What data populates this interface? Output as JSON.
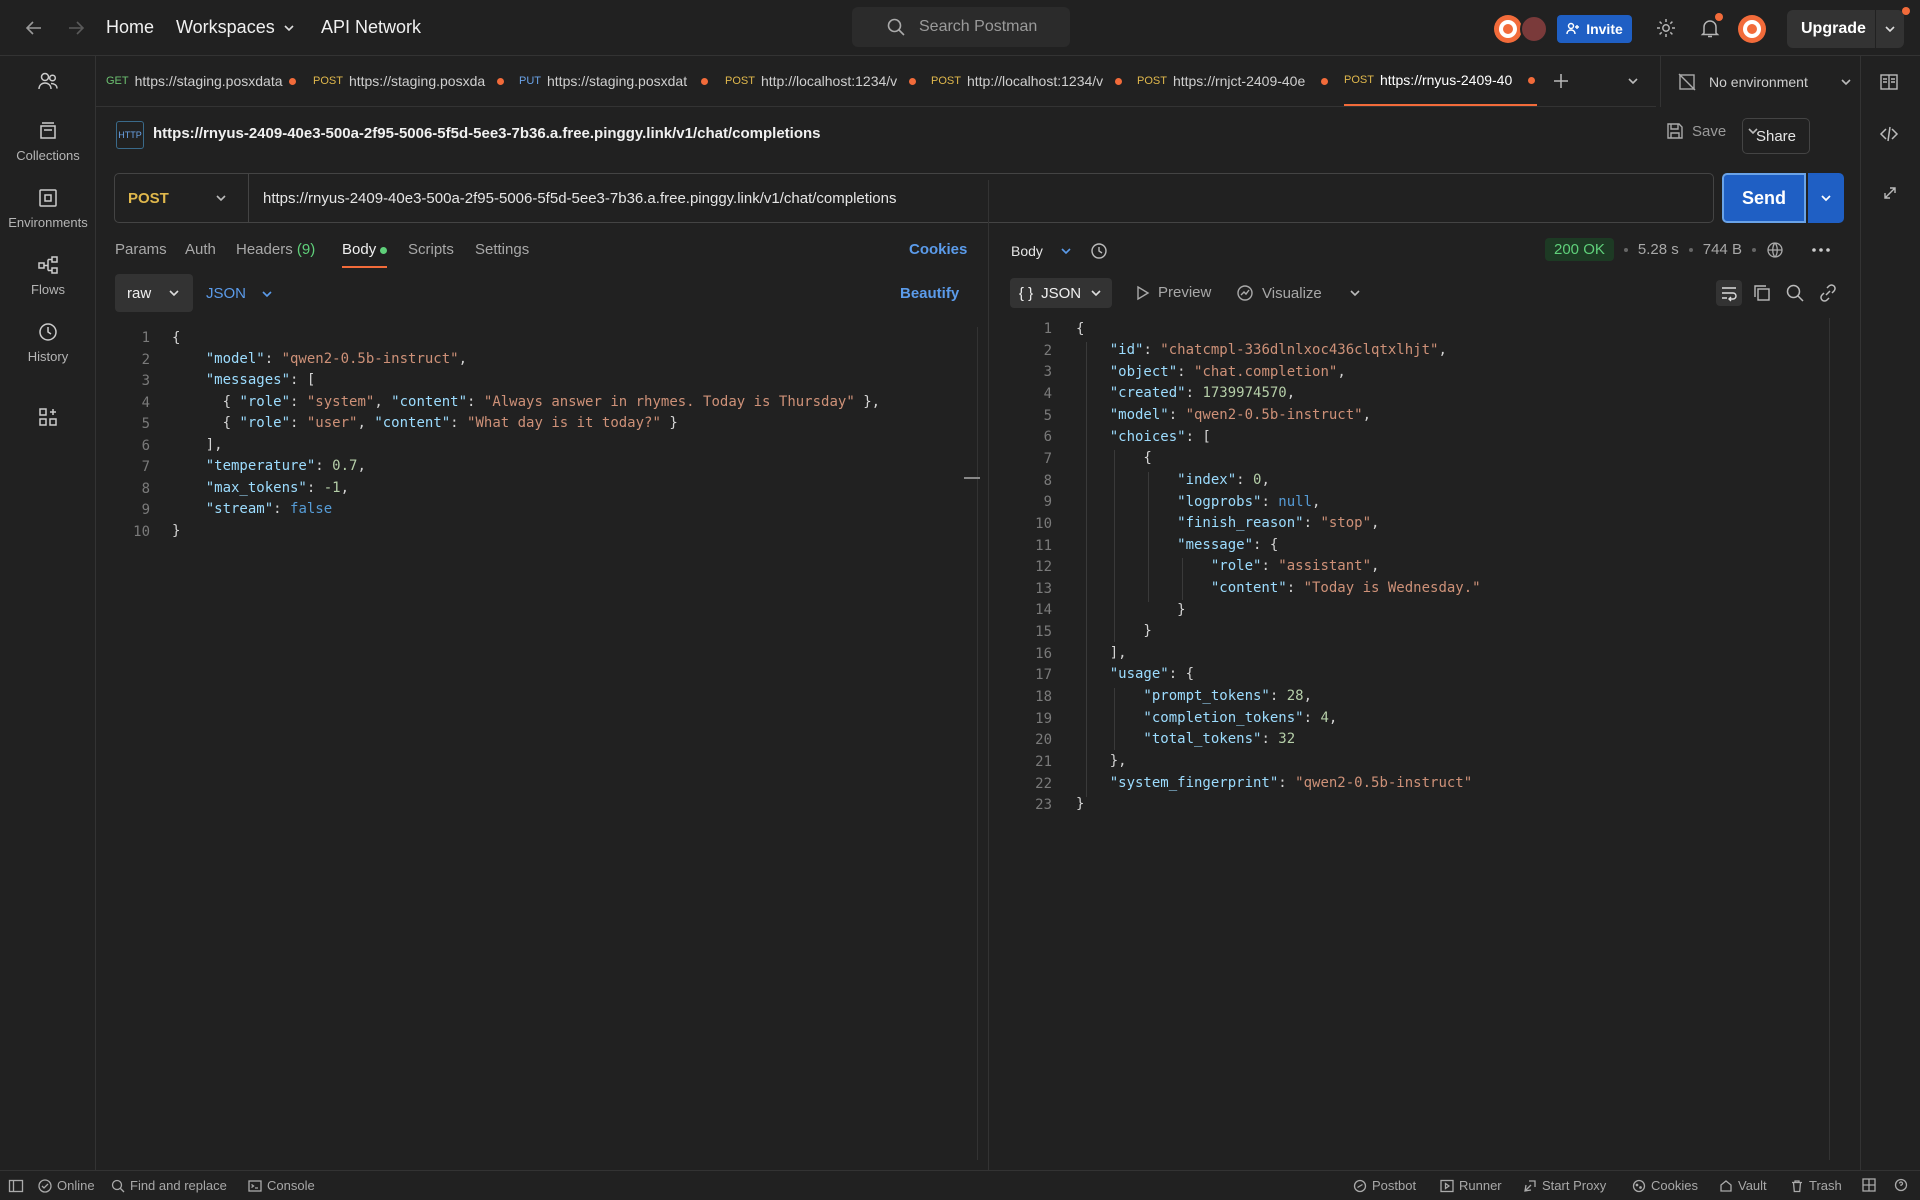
{
  "topbar": {
    "home": "Home",
    "workspaces": "Workspaces",
    "api_network": "API Network",
    "search_placeholder": "Search Postman",
    "invite": "Invite",
    "upgrade": "Upgrade"
  },
  "sidebar": {
    "items": [
      {
        "label": "Collections",
        "icon": "collections-icon"
      },
      {
        "label": "Environments",
        "icon": "environments-icon"
      },
      {
        "label": "Flows",
        "icon": "flows-icon"
      },
      {
        "label": "History",
        "icon": "history-icon"
      }
    ]
  },
  "tabs": [
    {
      "method": "GET",
      "title": "https://staging.posxdata"
    },
    {
      "method": "POST",
      "title": "https://staging.posxda"
    },
    {
      "method": "PUT",
      "title": "https://staging.posxdat"
    },
    {
      "method": "POST",
      "title": "http://localhost:1234/v"
    },
    {
      "method": "POST",
      "title": "http://localhost:1234/v"
    },
    {
      "method": "POST",
      "title": "https://rnjct-2409-40e"
    },
    {
      "method": "POST",
      "title": "https://rnyus-2409-40"
    }
  ],
  "environment": "No environment",
  "request": {
    "badge": "HTTP",
    "title": "https://rnyus-2409-40e3-500a-2f95-5006-5f5d-5ee3-7b36.a.free.pinggy.link/v1/chat/completions",
    "save": "Save",
    "share": "Share",
    "method": "POST",
    "url": "https://rnyus-2409-40e3-500a-2f95-5006-5f5d-5ee3-7b36.a.free.pinggy.link/v1/chat/completions",
    "send": "Send",
    "tabs": {
      "params": "Params",
      "auth": "Auth",
      "headers": "Headers",
      "headers_count": "(9)",
      "body": "Body",
      "scripts": "Scripts",
      "settings": "Settings"
    },
    "cookies": "Cookies",
    "body_mode": "raw",
    "body_lang": "JSON",
    "beautify": "Beautify",
    "line_numbers": [
      "1",
      "2",
      "3",
      "4",
      "5",
      "6",
      "7",
      "8",
      "9",
      "10"
    ]
  },
  "response": {
    "view": "Body",
    "status": "200 OK",
    "time": "5.28 s",
    "size": "744 B",
    "format": "JSON",
    "preview": "Preview",
    "visualize": "Visualize",
    "line_numbers": [
      "1",
      "2",
      "3",
      "4",
      "5",
      "6",
      "7",
      "8",
      "9",
      "10",
      "11",
      "12",
      "13",
      "14",
      "15",
      "16",
      "17",
      "18",
      "19",
      "20",
      "21",
      "22",
      "23"
    ]
  },
  "footer": {
    "online": "Online",
    "find_replace": "Find and replace",
    "console": "Console",
    "postbot": "Postbot",
    "runner": "Runner",
    "start_proxy": "Start Proxy",
    "cookies": "Cookies",
    "vault": "Vault",
    "trash": "Trash"
  },
  "colors": {
    "accent": "#f26b3a",
    "primary": "#1f5fc4",
    "post": "#e0b84c",
    "ok": "#5fd07a"
  }
}
